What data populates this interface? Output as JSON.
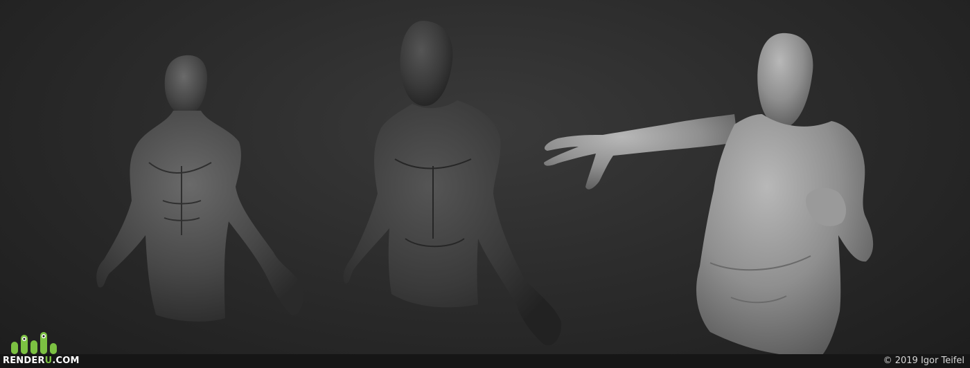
{
  "branding": {
    "logo_prefix": "RENDER",
    "logo_accent": "U",
    "logo_suffix": ".COM",
    "accent_color": "#7cc142"
  },
  "credit": {
    "text": "© 2019 Igor Teifel"
  },
  "figures": [
    {
      "name": "anatomy-bust",
      "shade": "#4a4a4a"
    },
    {
      "name": "dark-bust",
      "shade": "#3b3b3b"
    },
    {
      "name": "heavy-bust",
      "shade": "#8d8d8d"
    }
  ]
}
